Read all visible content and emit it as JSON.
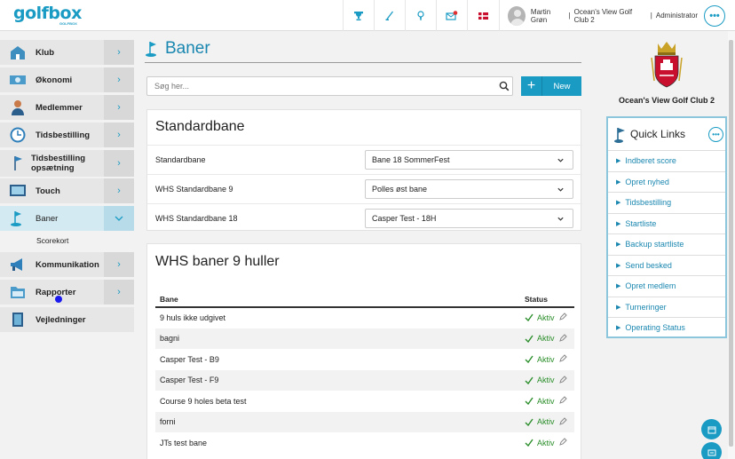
{
  "topbar": {
    "logo": "golfbox",
    "logo_sub": "GOLFBOX",
    "icons": [
      "trophy-icon",
      "golf-club-icon",
      "golf-ball-tee-icon",
      "message-icon",
      "flag-icon"
    ],
    "user_name": "Martin Grøn",
    "club": "Ocean's View Golf Club 2",
    "role": "Administrator"
  },
  "sidebar": {
    "items": [
      {
        "label": "Klub",
        "icon": "clubhouse-icon"
      },
      {
        "label": "Økonomi",
        "icon": "money-icon"
      },
      {
        "label": "Medlemmer",
        "icon": "members-icon"
      },
      {
        "label": "Tidsbestilling",
        "icon": "clock-icon"
      },
      {
        "label": "Tidsbestilling opsætning",
        "icon": "flag-pin-icon"
      },
      {
        "label": "Touch",
        "icon": "touch-screen-icon"
      },
      {
        "label": "Baner",
        "icon": "course-flag-icon"
      },
      {
        "label": "Kommunikation",
        "icon": "megaphone-icon"
      },
      {
        "label": "Rapporter",
        "icon": "folder-icon"
      },
      {
        "label": "Vejledninger",
        "icon": "book-icon"
      }
    ],
    "sub_item": "Scorekort"
  },
  "page": {
    "title": "Baner",
    "search_placeholder": "Søg her...",
    "new_label": "New",
    "plus_label": "+"
  },
  "standardbane": {
    "title": "Standardbane",
    "fields": [
      {
        "label": "Standardbane",
        "value": "Bane 18 SommerFest"
      },
      {
        "label": "WHS Standardbane 9",
        "value": "Polles øst bane"
      },
      {
        "label": "WHS Standardbane 18",
        "value": "Casper Test - 18H"
      }
    ]
  },
  "whs9": {
    "title": "WHS baner 9 huller",
    "col_bane": "Bane",
    "col_status": "Status",
    "rows": [
      {
        "name": "9 huls ikke udgivet",
        "status": "Aktiv"
      },
      {
        "name": "bagni",
        "status": "Aktiv"
      },
      {
        "name": "Casper Test - B9",
        "status": "Aktiv"
      },
      {
        "name": "Casper Test - F9",
        "status": "Aktiv"
      },
      {
        "name": "Course 9 holes beta test",
        "status": "Aktiv"
      },
      {
        "name": "forni",
        "status": "Aktiv"
      },
      {
        "name": "JTs test bane",
        "status": "Aktiv"
      }
    ]
  },
  "right": {
    "club_name": "Ocean's View Golf Club 2",
    "quick_links_title": "Quick Links",
    "quick_links": [
      "Indberet score",
      "Opret nyhed",
      "Tidsbestilling",
      "Startliste",
      "Backup startliste",
      "Send besked",
      "Opret medlem",
      "Turneringer",
      "Operating Status"
    ]
  },
  "colors": {
    "accent": "#1a9bc4",
    "status_green": "#2a8e2a"
  }
}
